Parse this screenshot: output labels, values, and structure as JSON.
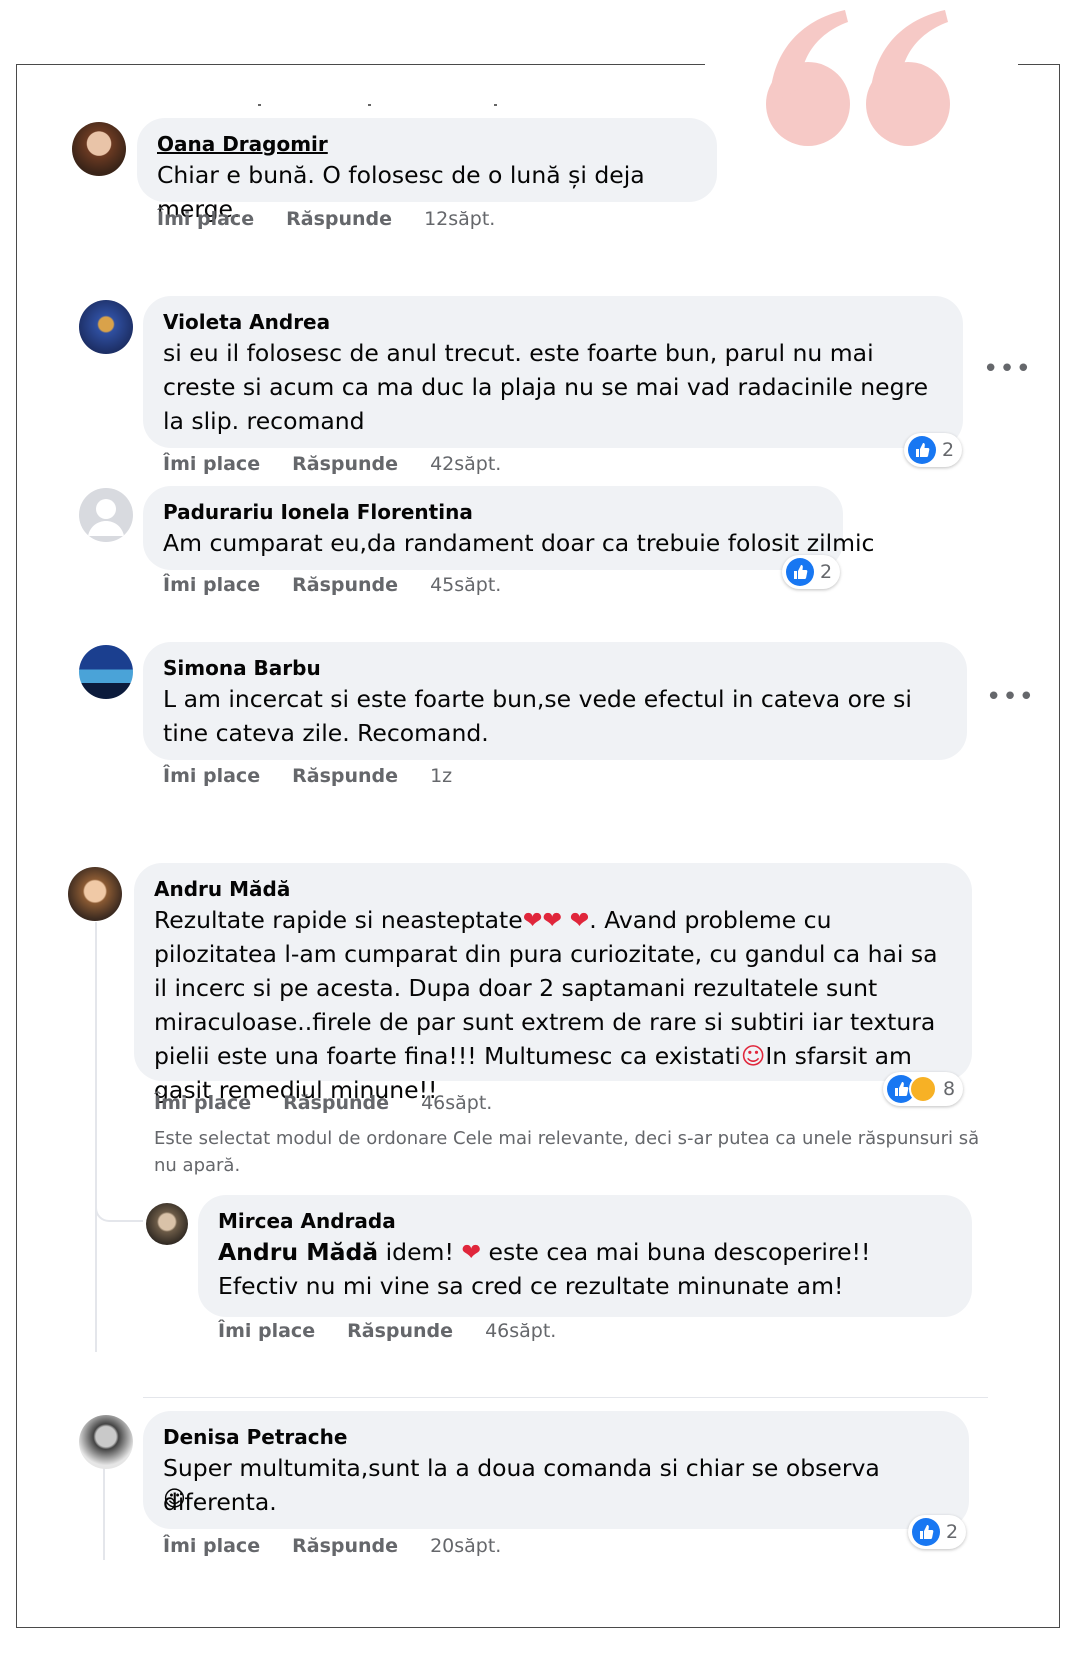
{
  "actions": {
    "like": "Îmi place",
    "reply": "Răspunde"
  },
  "comments": [
    {
      "author": "Oana Dragomir",
      "text": "Chiar e bună. O folosesc de o lună și deja merge.",
      "time": "12săpt."
    },
    {
      "author": "Violeta Andrea",
      "text": "si eu il folosesc de anul trecut. este foarte bun, parul nu mai creste si acum ca ma duc la plaja nu se mai vad radacinile negre la slip. recomand",
      "time": "42săpt.",
      "reactions": "2"
    },
    {
      "author": "Padurariu Ionela Florentina",
      "text": "Am cumparat eu,da randament doar ca trebuie folosit zilmic",
      "time": "45săpt.",
      "reactions": "2"
    },
    {
      "author": "Simona Barbu",
      "text": "L am incercat si este foarte bun,se vede efectul in cateva ore si tine cateva zile. Recomand.",
      "time": "1z"
    },
    {
      "author": "Andru Mădă",
      "text_a": "Rezultate rapide si neasteptate",
      "text_b": ". Avand probleme cu pilozitatea l-am cumparat din pura curiozitate, cu gandul ca hai sa il incerc si pe acesta. Dupa doar 2 saptamani rezultatele sunt miraculoase..firele de par sunt extrem de rare si subtiri iar textura pielii este una foarte fina!!! Multumesc ca existati",
      "text_c": "In sfarsit am gasit remediul minune!!",
      "time": "46săpt.",
      "reactions": "8"
    },
    {
      "author": "Mircea Andrada",
      "mention": "Andru Mădă",
      "text_a": " idem! ",
      "text_b": " este cea mai buna descoperire!! Efectiv nu mi vine sa cred ce rezultate minunate am!",
      "time": "46săpt."
    },
    {
      "author": "Denisa Petrache",
      "text": "Super multumita,sunt la a doua comanda si chiar se observa diferenta.",
      "time": "20săpt.",
      "reactions": "2"
    }
  ],
  "notice": "Este selectat modul de ordonare Cele mai relevante, deci s-ar putea ca unele răspunsuri să nu apară.",
  "icons": {
    "quote": "quote-mark-icon",
    "more": "more-options-icon",
    "like": "like-reaction-icon",
    "haha": "haha-reaction-icon",
    "heart": "heart-emoji-icon"
  },
  "colors": {
    "quote": "#f6c9c6",
    "bubble": "#f0f2f5",
    "like": "#1877f2",
    "meta": "#65676b"
  }
}
